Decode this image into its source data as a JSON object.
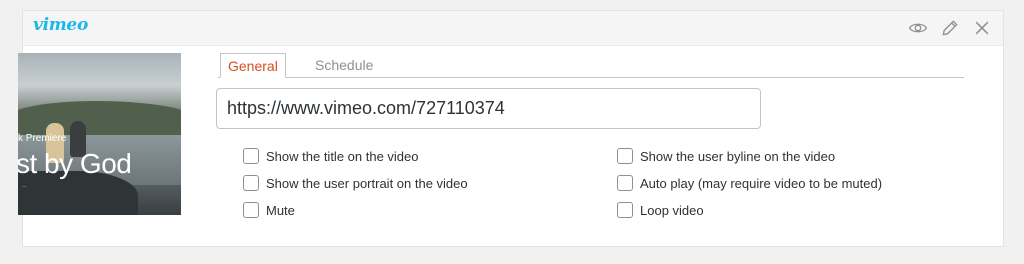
{
  "header": {
    "logo": "vimeo",
    "actions": [
      {
        "name": "preview",
        "icon": "eye-icon"
      },
      {
        "name": "edit",
        "icon": "pencil-icon"
      },
      {
        "name": "remove",
        "icon": "close-icon"
      }
    ]
  },
  "thumbnail": {
    "overlay_sub": "k Premiere",
    "overlay_title": "st by God",
    "overlay_small": "..."
  },
  "tabs": [
    {
      "label": "General",
      "active": true
    },
    {
      "label": "Schedule",
      "active": false
    }
  ],
  "url_field": {
    "value": "https://www.vimeo.com/727110374"
  },
  "options": [
    {
      "label": "Show the title on the video",
      "checked": false
    },
    {
      "label": "Show the user byline on the video",
      "checked": false
    },
    {
      "label": "Show the user portrait on the video",
      "checked": false
    },
    {
      "label": "Auto play (may require video to be muted)",
      "checked": false
    },
    {
      "label": "Mute",
      "checked": false
    },
    {
      "label": "Loop video",
      "checked": false
    }
  ],
  "colors": {
    "brand": "#1ab7ea",
    "active_tab": "#d54e21",
    "border": "#c3c4c7"
  }
}
